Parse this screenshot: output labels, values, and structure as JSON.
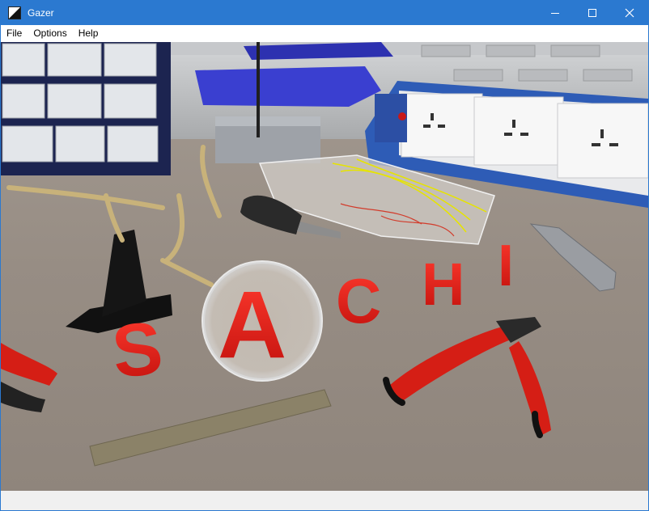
{
  "window": {
    "title": "Gazer",
    "title_color": "#2b79d0",
    "icons": [
      "app-icon",
      "minimize-icon",
      "maximize-icon",
      "close-icon"
    ]
  },
  "menu": {
    "items": [
      {
        "label": "File"
      },
      {
        "label": "Options"
      },
      {
        "label": "Help"
      }
    ]
  },
  "scene": {
    "letters": [
      "S",
      "A",
      "C",
      "H",
      "I"
    ],
    "accent": "#e81d1d"
  }
}
